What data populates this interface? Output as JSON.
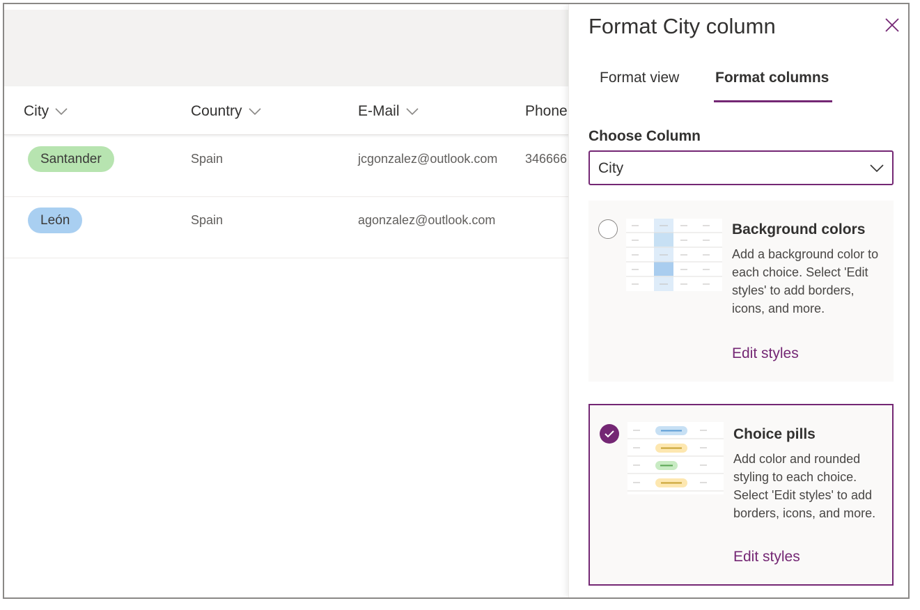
{
  "list": {
    "columns": [
      {
        "label": "City"
      },
      {
        "label": "Country"
      },
      {
        "label": "E-Mail"
      },
      {
        "label": "Phone"
      }
    ],
    "rows": [
      {
        "city": "Santander",
        "city_color": "#b7e4b0",
        "country": "Spain",
        "email": "jcgonzalez@outlook.com",
        "phone": "346666"
      },
      {
        "city": "León",
        "city_color": "#a9cff1",
        "country": "Spain",
        "email": "agonzalez@outlook.com",
        "phone": ""
      }
    ]
  },
  "panel": {
    "title": "Format City column",
    "close_icon": "close-icon",
    "tabs": [
      {
        "label": "Format view",
        "active": false
      },
      {
        "label": "Format columns",
        "active": true
      }
    ],
    "choose_column_label": "Choose Column",
    "column_select_value": "City",
    "options": [
      {
        "title": "Background colors",
        "description": "Add a background color to each choice. Select 'Edit styles' to add borders, icons, and more.",
        "link": "Edit styles",
        "selected": false
      },
      {
        "title": "Choice pills",
        "description": "Add color and rounded styling to each choice. Select 'Edit styles' to add borders, icons, and more.",
        "link": "Edit styles",
        "selected": true
      }
    ]
  },
  "colors": {
    "accent": "#742774",
    "pill_green": "#b7e4b0",
    "pill_blue": "#a9cff1"
  }
}
